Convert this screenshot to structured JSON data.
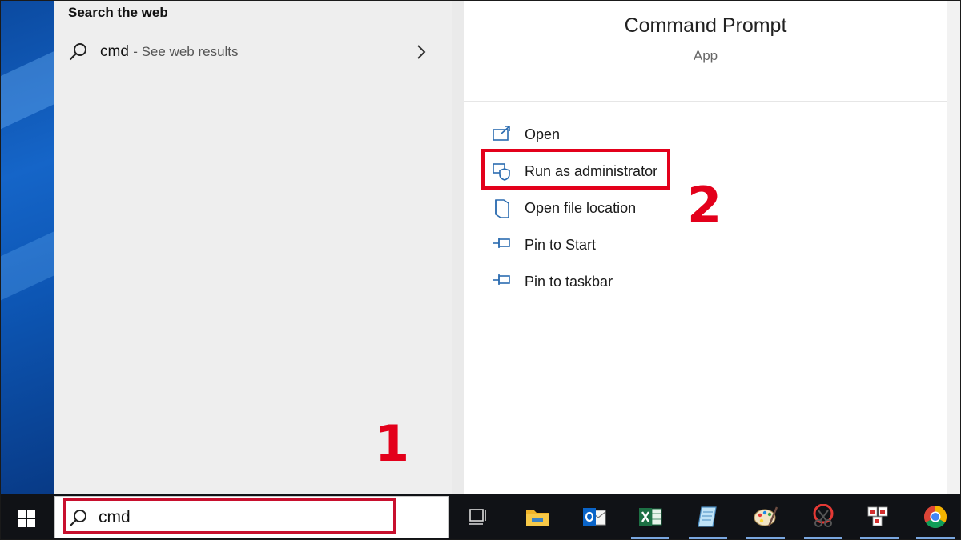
{
  "search_results": {
    "heading": "Search the web",
    "web_item": {
      "query": "cmd",
      "suffix": "- See web results"
    }
  },
  "detail": {
    "app_name": "Command Prompt",
    "app_type": "App",
    "actions": [
      {
        "label": "Open",
        "icon": "open-window-icon"
      },
      {
        "label": "Run as administrator",
        "icon": "shield-icon"
      },
      {
        "label": "Open file location",
        "icon": "file-location-icon"
      },
      {
        "label": "Pin to Start",
        "icon": "pin-icon"
      },
      {
        "label": "Pin to taskbar",
        "icon": "pin-icon"
      }
    ]
  },
  "annotations": {
    "step1": "1",
    "step2": "2"
  },
  "taskbar": {
    "search_value": "cmd",
    "icons": [
      "task-view-icon",
      "file-explorer-icon",
      "outlook-icon",
      "excel-icon",
      "notepad-icon",
      "paint-icon",
      "snipping-tool-icon",
      "unikey-icon",
      "chrome-icon"
    ]
  },
  "colors": {
    "annotation_red": "#e3001b",
    "taskbar": "#101216",
    "pane_bg": "#eeeeee"
  }
}
